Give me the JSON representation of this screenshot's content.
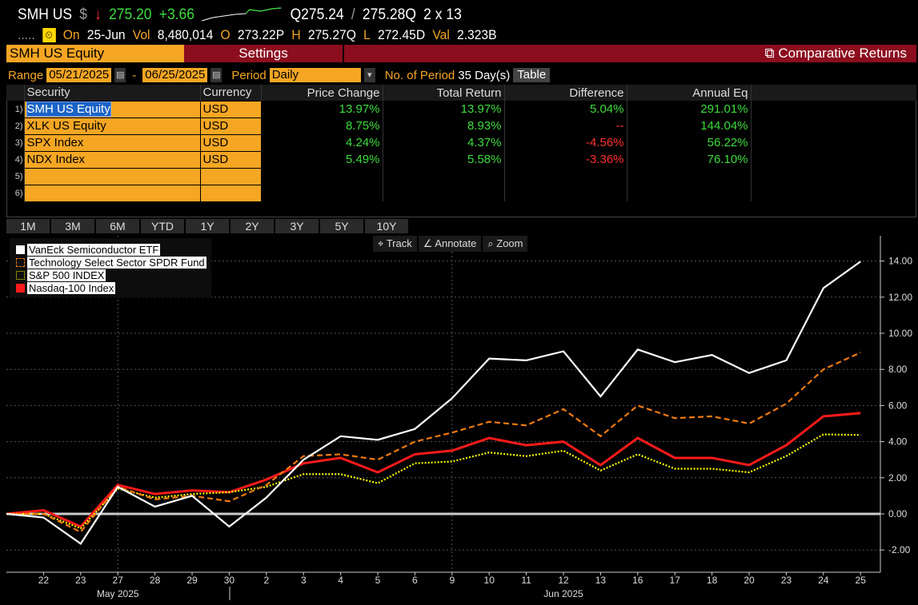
{
  "header": {
    "ticker": "SMH US",
    "currency_symbol": "$",
    "arrow": "↓",
    "last": "275.20",
    "change": "+3.66",
    "bid": "Q275.24",
    "ask": "275.28Q",
    "size": "2 x 13",
    "dots": ".....",
    "on_label": "On",
    "date": "25-Jun",
    "vol_label": "Vol",
    "vol": "8,480,014",
    "open_label": "O",
    "open": "273.22P",
    "high_label": "H",
    "high": "275.27Q",
    "low_label": "L",
    "low": "272.45D",
    "val_label": "Val",
    "val": "2.323B"
  },
  "toolbar": {
    "security": "SMH US Equity",
    "settings": "Settings",
    "comparative": "Comparative Returns"
  },
  "range": {
    "label": "Range",
    "start": "05/21/2025",
    "sep": "-",
    "end": "06/25/2025",
    "period_label": "Period",
    "period": "Daily",
    "nperiod_label": "No. of Period",
    "nperiod": "35 Day(s)",
    "table_btn": "Table"
  },
  "table": {
    "headers": [
      "Security",
      "Currency",
      "Price Change",
      "Total Return",
      "Difference",
      "Annual Eq"
    ],
    "rows": [
      {
        "n": "1)",
        "security": "SMH US Equity",
        "currency": "USD",
        "price_change": "13.97%",
        "total_return": "13.97%",
        "difference": "5.04%",
        "annual_eq": "291.01%"
      },
      {
        "n": "2)",
        "security": "XLK US Equity",
        "currency": "USD",
        "price_change": "8.75%",
        "total_return": "8.93%",
        "difference": "--",
        "annual_eq": "144.04%"
      },
      {
        "n": "3)",
        "security": "SPX Index",
        "currency": "USD",
        "price_change": "4.24%",
        "total_return": "4.37%",
        "difference": "-4.56%",
        "annual_eq": "56.22%"
      },
      {
        "n": "4)",
        "security": "NDX Index",
        "currency": "USD",
        "price_change": "5.49%",
        "total_return": "5.58%",
        "difference": "-3.36%",
        "annual_eq": "76.10%"
      },
      {
        "n": "5)",
        "security": "",
        "currency": "",
        "price_change": "",
        "total_return": "",
        "difference": "",
        "annual_eq": ""
      },
      {
        "n": "6)",
        "security": "",
        "currency": "",
        "price_change": "",
        "total_return": "",
        "difference": "",
        "annual_eq": ""
      }
    ]
  },
  "periods": [
    "1M",
    "3M",
    "6M",
    "YTD",
    "1Y",
    "2Y",
    "3Y",
    "5Y",
    "10Y"
  ],
  "chart_tools": {
    "track": "Track",
    "annotate": "Annotate",
    "zoom": "Zoom"
  },
  "chart_data": {
    "type": "line",
    "title": "Comparative Returns",
    "ylabel": "%",
    "ylim": [
      -3,
      15
    ],
    "grid": true,
    "legend": "top-left",
    "x": [
      "21",
      "22",
      "23",
      "27",
      "28",
      "29",
      "30",
      "2",
      "3",
      "4",
      "5",
      "6",
      "9",
      "10",
      "11",
      "12",
      "13",
      "16",
      "17",
      "18",
      "20",
      "23",
      "24",
      "25"
    ],
    "month_labels": [
      {
        "label": "May 2025",
        "at": "27"
      },
      {
        "label": "Jun 2025",
        "at": "12"
      }
    ],
    "yticks": [
      -2,
      0,
      2,
      4,
      6,
      8,
      10,
      12,
      14
    ],
    "series": [
      {
        "name": "VanEck Semiconductor ETF",
        "color": "#ffffff",
        "style": "solid",
        "values": [
          0,
          -0.2,
          -1.65,
          1.5,
          0.4,
          1.0,
          -0.7,
          0.9,
          3.0,
          4.3,
          4.1,
          4.7,
          6.4,
          8.6,
          8.5,
          9.0,
          6.5,
          9.1,
          8.4,
          8.8,
          7.8,
          8.5,
          12.5,
          13.97
        ]
      },
      {
        "name": "Technology Select Sector SPDR Fund",
        "color": "#f07a10",
        "style": "dashed",
        "values": [
          0,
          0,
          -1.0,
          1.5,
          0.8,
          1.0,
          0.7,
          1.6,
          3.2,
          3.3,
          3.0,
          4.0,
          4.5,
          5.1,
          4.9,
          5.8,
          4.3,
          6.0,
          5.3,
          5.4,
          5.0,
          6.1,
          8.0,
          8.93
        ]
      },
      {
        "name": "S&P 500 INDEX",
        "color": "#ffff00",
        "style": "dotted",
        "values": [
          0,
          0,
          -0.8,
          1.4,
          0.9,
          1.1,
          1.2,
          1.5,
          2.2,
          2.2,
          1.7,
          2.8,
          2.9,
          3.4,
          3.2,
          3.5,
          2.4,
          3.3,
          2.5,
          2.5,
          2.3,
          3.2,
          4.4,
          4.37
        ]
      },
      {
        "name": "Nasdaq-100 Index",
        "color": "#ff1a1a",
        "style": "solid",
        "values": [
          0,
          0.2,
          -0.7,
          1.6,
          1.1,
          1.3,
          1.2,
          1.9,
          2.8,
          3.1,
          2.3,
          3.3,
          3.5,
          4.2,
          3.8,
          4.0,
          2.7,
          4.2,
          3.1,
          3.1,
          2.7,
          3.8,
          5.4,
          5.58
        ]
      }
    ]
  }
}
